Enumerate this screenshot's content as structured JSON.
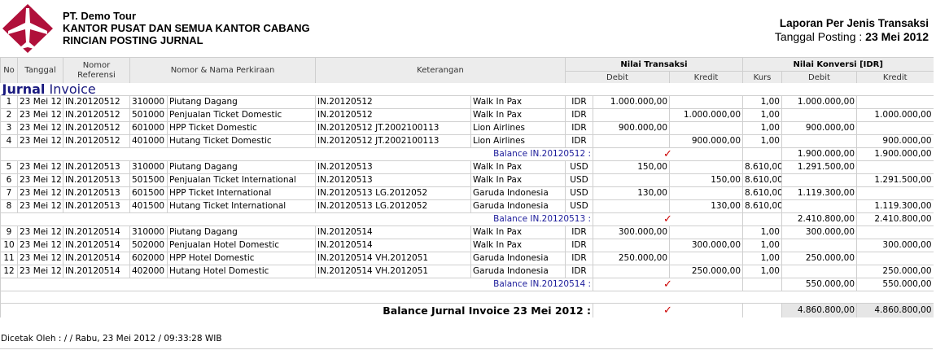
{
  "company": {
    "name": "PT. Demo Tour",
    "line2": "KANTOR PUSAT DAN SEMUA KANTOR CABANG",
    "line3": "RINCIAN POSTING JURNAL"
  },
  "report": {
    "title": "Laporan Per Jenis Transaksi",
    "posting_label": "Tanggal Posting :",
    "posting_date": "23 Mei 2012"
  },
  "columns": {
    "no": "No",
    "tanggal": "Tanggal",
    "nomor_referensi": "Nomor Referensi",
    "perkiraan": "Nomor & Nama Perkiraan",
    "keterangan": "Keterangan",
    "nilai_transaksi": "Nilai Transaksi",
    "nilai_konversi": "Nilai Konversi [IDR]",
    "debit": "Debit",
    "kredit": "Kredit",
    "kurs": "Kurs"
  },
  "section": {
    "label_bold": "Jurnal",
    "label_rest": "Invoice"
  },
  "groups": [
    {
      "rows": [
        {
          "no": "1",
          "tanggal": "23 Mei 12",
          "ref": "IN.20120512",
          "akun": "310000",
          "nama": "Piutang Dagang",
          "ket1": "IN.20120512",
          "ket2": "Walk In Pax",
          "cur": "IDR",
          "debit": "1.000.000,00",
          "kredit": "",
          "kurs": "1,00",
          "kdebit": "1.000.000,00",
          "kkredit": ""
        },
        {
          "no": "2",
          "tanggal": "23 Mei 12",
          "ref": "IN.20120512",
          "akun": "501000",
          "nama": "Penjualan Ticket Domestic",
          "ket1": "IN.20120512",
          "ket2": "Walk In Pax",
          "cur": "IDR",
          "debit": "",
          "kredit": "1.000.000,00",
          "kurs": "1,00",
          "kdebit": "",
          "kkredit": "1.000.000,00"
        },
        {
          "no": "3",
          "tanggal": "23 Mei 12",
          "ref": "IN.20120512",
          "akun": "601000",
          "nama": "HPP Ticket Domestic",
          "ket1": "IN.20120512 JT.2002100113",
          "ket2": "Lion Airlines",
          "cur": "IDR",
          "debit": "900.000,00",
          "kredit": "",
          "kurs": "1,00",
          "kdebit": "900.000,00",
          "kkredit": ""
        },
        {
          "no": "4",
          "tanggal": "23 Mei 12",
          "ref": "IN.20120512",
          "akun": "401000",
          "nama": "Hutang Ticket Domestic",
          "ket1": "IN.20120512 JT.2002100113",
          "ket2": "Lion Airlines",
          "cur": "IDR",
          "debit": "",
          "kredit": "900.000,00",
          "kurs": "1,00",
          "kdebit": "",
          "kkredit": "900.000,00"
        }
      ],
      "balance": {
        "label": "Balance IN.20120512 :",
        "check": "✓",
        "debit": "1.900.000,00",
        "kredit": "1.900.000,00"
      }
    },
    {
      "rows": [
        {
          "no": "5",
          "tanggal": "23 Mei 12",
          "ref": "IN.20120513",
          "akun": "310000",
          "nama": "Piutang Dagang",
          "ket1": "IN.20120513",
          "ket2": "Walk In Pax",
          "cur": "USD",
          "debit": "150,00",
          "kredit": "",
          "kurs": "8.610,00",
          "kdebit": "1.291.500,00",
          "kkredit": ""
        },
        {
          "no": "6",
          "tanggal": "23 Mei 12",
          "ref": "IN.20120513",
          "akun": "501500",
          "nama": "Penjualan Ticket International",
          "ket1": "IN.20120513",
          "ket2": "Walk In Pax",
          "cur": "USD",
          "debit": "",
          "kredit": "150,00",
          "kurs": "8.610,00",
          "kdebit": "",
          "kkredit": "1.291.500,00"
        },
        {
          "no": "7",
          "tanggal": "23 Mei 12",
          "ref": "IN.20120513",
          "akun": "601500",
          "nama": "HPP Ticket International",
          "ket1": "IN.20120513 LG.2012052",
          "ket2": "Garuda Indonesia",
          "cur": "USD",
          "debit": "130,00",
          "kredit": "",
          "kurs": "8.610,00",
          "kdebit": "1.119.300,00",
          "kkredit": ""
        },
        {
          "no": "8",
          "tanggal": "23 Mei 12",
          "ref": "IN.20120513",
          "akun": "401500",
          "nama": "Hutang Ticket International",
          "ket1": "IN.20120513 LG.2012052",
          "ket2": "Garuda Indonesia",
          "cur": "USD",
          "debit": "",
          "kredit": "130,00",
          "kurs": "8.610,00",
          "kdebit": "",
          "kkredit": "1.119.300,00"
        }
      ],
      "balance": {
        "label": "Balance IN.20120513 :",
        "check": "✓",
        "debit": "2.410.800,00",
        "kredit": "2.410.800,00"
      }
    },
    {
      "rows": [
        {
          "no": "9",
          "tanggal": "23 Mei 12",
          "ref": "IN.20120514",
          "akun": "310000",
          "nama": "Piutang Dagang",
          "ket1": "IN.20120514",
          "ket2": "Walk In Pax",
          "cur": "IDR",
          "debit": "300.000,00",
          "kredit": "",
          "kurs": "1,00",
          "kdebit": "300.000,00",
          "kkredit": ""
        },
        {
          "no": "10",
          "tanggal": "23 Mei 12",
          "ref": "IN.20120514",
          "akun": "502000",
          "nama": "Penjualan Hotel Domestic",
          "ket1": "IN.20120514",
          "ket2": "Walk In Pax",
          "cur": "IDR",
          "debit": "",
          "kredit": "300.000,00",
          "kurs": "1,00",
          "kdebit": "",
          "kkredit": "300.000,00"
        },
        {
          "no": "11",
          "tanggal": "23 Mei 12",
          "ref": "IN.20120514",
          "akun": "602000",
          "nama": "HPP Hotel Domestic",
          "ket1": "IN.20120514 VH.2012051",
          "ket2": "Garuda Indonesia",
          "cur": "IDR",
          "debit": "250.000,00",
          "kredit": "",
          "kurs": "1,00",
          "kdebit": "250.000,00",
          "kkredit": ""
        },
        {
          "no": "12",
          "tanggal": "23 Mei 12",
          "ref": "IN.20120514",
          "akun": "402000",
          "nama": "Hutang Hotel Domestic",
          "ket1": "IN.20120514 VH.2012051",
          "ket2": "Garuda Indonesia",
          "cur": "IDR",
          "debit": "",
          "kredit": "250.000,00",
          "kurs": "1,00",
          "kdebit": "",
          "kkredit": "250.000,00"
        }
      ],
      "balance": {
        "label": "Balance IN.20120514 :",
        "check": "✓",
        "debit": "550.000,00",
        "kredit": "550.000,00"
      }
    }
  ],
  "total": {
    "label": "Balance Jurnal Invoice 23 Mei 2012 :",
    "check": "✓",
    "debit": "4.860.800,00",
    "kredit": "4.860.800,00"
  },
  "footer": {
    "printed_by": "Dicetak Oleh : / / Rabu, 23 Mei 2012 / 09:33:28 WIB"
  },
  "logo": {
    "icon": "airplane-logo-icon",
    "color": "#b0103a"
  }
}
